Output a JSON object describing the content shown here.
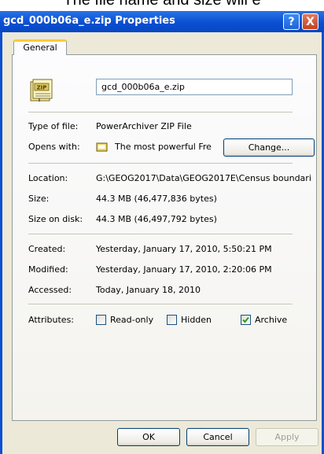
{
  "caption_partial": "The file name and size will e",
  "window": {
    "title": "gcd_000b06a_e.zip Properties",
    "help_glyph": "?",
    "close_glyph": "X"
  },
  "tabs": [
    {
      "label": "General"
    }
  ],
  "file": {
    "name": "gcd_000b06a_e.zip",
    "icon_text": "ZIP"
  },
  "info": {
    "type_label": "Type of file:",
    "type_value": "PowerArchiver ZIP File",
    "opens_label": "Opens with:",
    "opens_value": "The most powerful Fre",
    "change_button": "Change...",
    "location_label": "Location:",
    "location_value": "G:\\GEOG2017\\Data\\GEOG2017E\\Census boundari",
    "size_label": "Size:",
    "size_value": "44.3 MB (46,477,836 bytes)",
    "size_on_disk_label": "Size on disk:",
    "size_on_disk_value": "44.3 MB (46,497,792 bytes)",
    "created_label": "Created:",
    "created_value": "Yesterday, January 17, 2010, 5:50:21 PM",
    "modified_label": "Modified:",
    "modified_value": "Yesterday, January 17, 2010, 2:20:06 PM",
    "accessed_label": "Accessed:",
    "accessed_value": "Today, January 18, 2010",
    "attributes_label": "Attributes:"
  },
  "attributes": {
    "readonly": {
      "label": "Read-only",
      "checked": false
    },
    "hidden": {
      "label": "Hidden",
      "checked": false
    },
    "archive": {
      "label": "Archive",
      "checked": true
    }
  },
  "buttons": {
    "ok": "OK",
    "cancel": "Cancel",
    "apply": "Apply"
  },
  "colors": {
    "titlebar": "#0a4fd2",
    "dialog_bg": "#ece9d8",
    "tab_accent": "#ffc83c"
  }
}
